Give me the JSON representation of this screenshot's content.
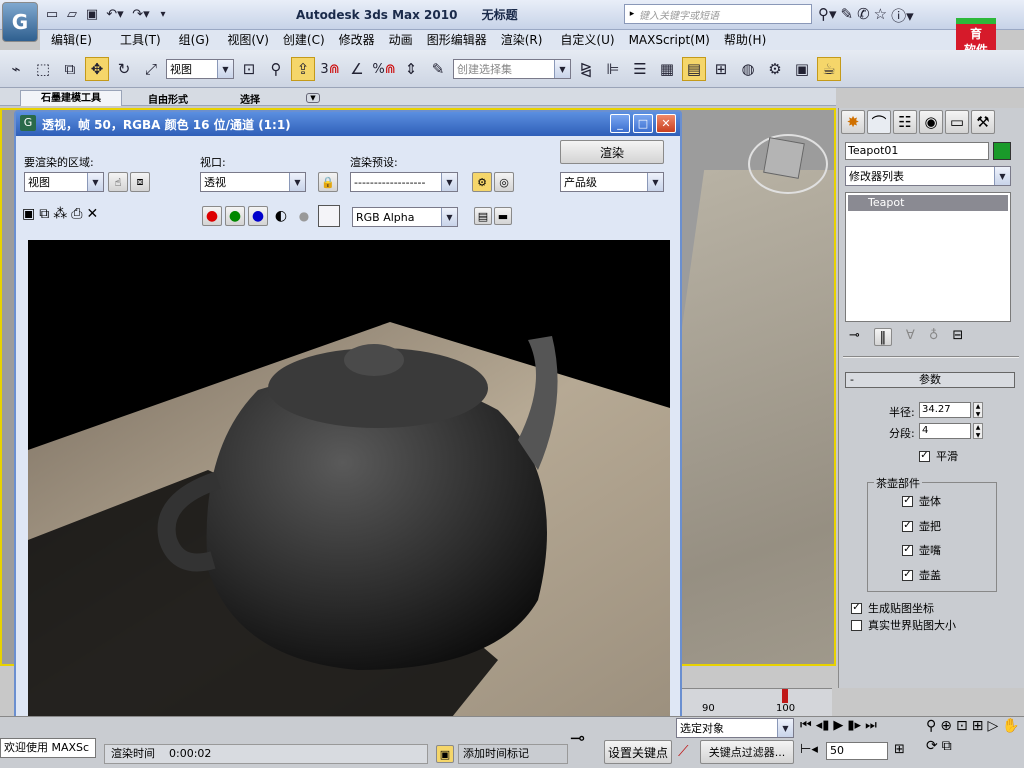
{
  "title_bar": {
    "app": "Autodesk 3ds Max  2010",
    "doc": "无标题",
    "search_placeholder": "键入关键字或短语"
  },
  "menu": [
    "编辑(E)",
    "工具(T)",
    "组(G)",
    "视图(V)",
    "创建(C)",
    "修改器",
    "动画",
    "图形编辑器",
    "渲染(R)",
    "自定义(U)",
    "MAXScript(M)",
    "帮助(H)"
  ],
  "toolbar": {
    "ref_coord": "视图",
    "count1": "3",
    "count2": "%",
    "selset_placeholder": "创建选择集"
  },
  "ribbon_tabs": [
    "石墨建模工具",
    "自由形式",
    "选择"
  ],
  "logo": {
    "line1": "育",
    "line2": "软件"
  },
  "render_window": {
    "title": "透视，帧 50，RGBA 颜色 16 位/通道 (1:1)",
    "area_label": "要渲染的区域:",
    "area_value": "视图",
    "viewport_label": "视口:",
    "viewport_value": "透视",
    "preset_label": "渲染预设:",
    "preset_value": "------------------",
    "render_button": "渲染",
    "quality_value": "产品级",
    "channel_value": "RGB Alpha"
  },
  "command_panel": {
    "object_name": "Teapot01",
    "object_color": "#1a9a2a",
    "modifier_list": "修改器列表",
    "stack_item": "Teapot",
    "rollout_title": "参数",
    "radius_label": "半径:",
    "radius_value": "34.27",
    "segments_label": "分段:",
    "segments_value": "4",
    "smooth_label": "平滑",
    "parts_label": "茶壶部件",
    "parts": [
      "壶体",
      "壶把",
      "壶嘴",
      "壶盖"
    ],
    "gen_mapping": "生成贴图坐标",
    "real_world": "真实世界贴图大小"
  },
  "timeline": {
    "ticks": [
      "90",
      "100"
    ],
    "pos": 100
  },
  "status": {
    "welcome": "欢迎使用 MAXSc",
    "render_time_label": "渲染时间",
    "render_time": "0:00:02",
    "add_tag": "添加时间标记",
    "set_key": "设置关键点",
    "key_filter": "关键点过滤器...",
    "selected": "选定对象",
    "frame": "50"
  }
}
